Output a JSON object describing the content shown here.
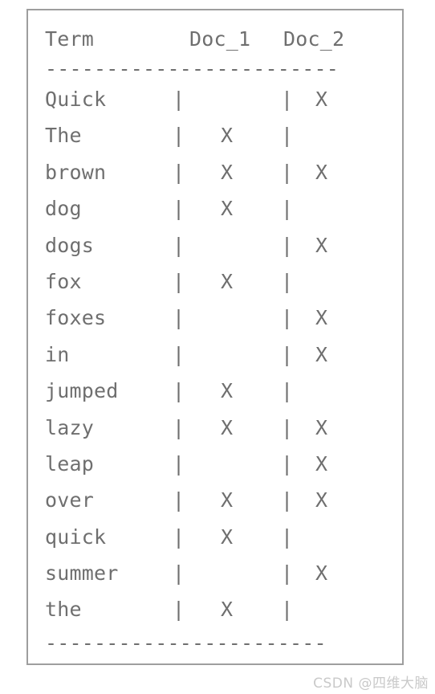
{
  "panel": {
    "border_color": "#9e9e9e",
    "background_color": "#ffffff",
    "text_color": "#6f6f6f"
  },
  "table": {
    "columns": [
      "Term",
      "Doc_1",
      "Doc_2"
    ],
    "separator_top": "------------------------",
    "separator_bottom": "-----------------------",
    "pipe": "|",
    "mark": "X",
    "blank": "",
    "rows": [
      {
        "term": "Quick",
        "doc_1": "",
        "doc_2": "X"
      },
      {
        "term": "The",
        "doc_1": "X",
        "doc_2": ""
      },
      {
        "term": "brown",
        "doc_1": "X",
        "doc_2": "X"
      },
      {
        "term": "dog",
        "doc_1": "X",
        "doc_2": ""
      },
      {
        "term": "dogs",
        "doc_1": "",
        "doc_2": "X"
      },
      {
        "term": "fox",
        "doc_1": "X",
        "doc_2": ""
      },
      {
        "term": "foxes",
        "doc_1": "",
        "doc_2": "X"
      },
      {
        "term": "in",
        "doc_1": "",
        "doc_2": "X"
      },
      {
        "term": "jumped",
        "doc_1": "X",
        "doc_2": ""
      },
      {
        "term": "lazy",
        "doc_1": "X",
        "doc_2": "X"
      },
      {
        "term": "leap",
        "doc_1": "",
        "doc_2": "X"
      },
      {
        "term": "over",
        "doc_1": "X",
        "doc_2": "X"
      },
      {
        "term": "quick",
        "doc_1": "X",
        "doc_2": ""
      },
      {
        "term": "summer",
        "doc_1": "",
        "doc_2": "X"
      },
      {
        "term": "the",
        "doc_1": "X",
        "doc_2": ""
      }
    ]
  },
  "watermark": {
    "text": "CSDN @四维大脑"
  }
}
